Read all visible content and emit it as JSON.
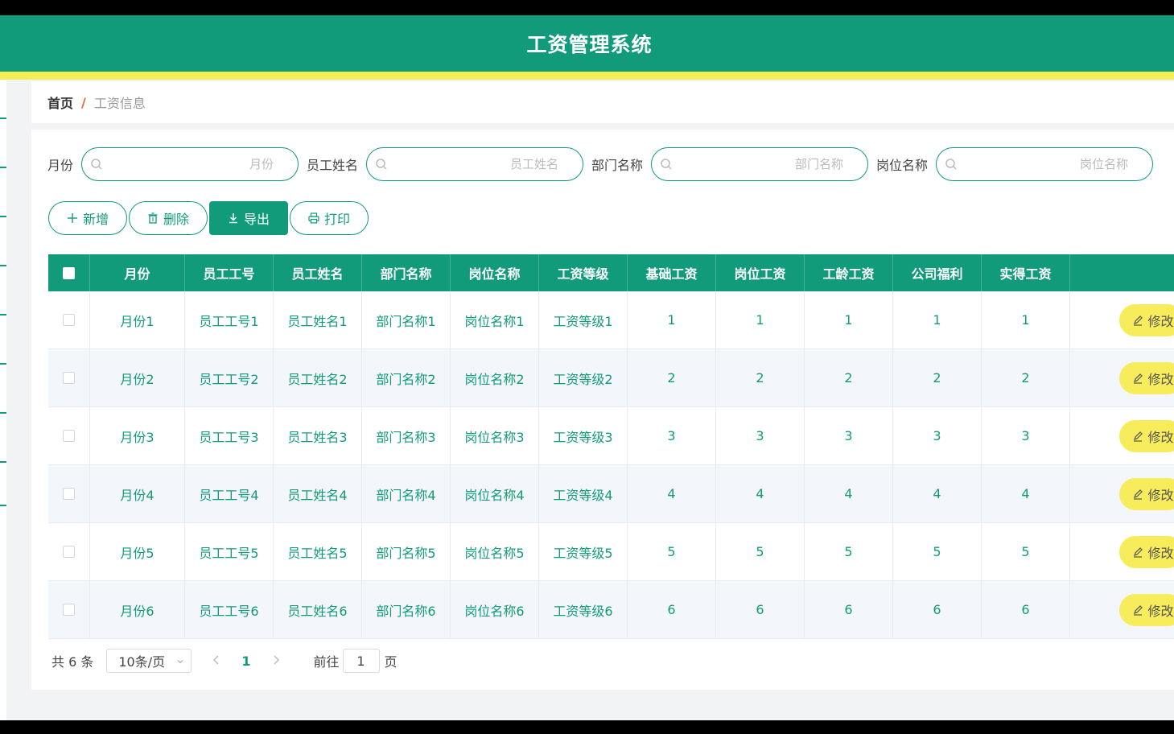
{
  "app": {
    "title": "工资管理系统"
  },
  "breadcrumb": {
    "home": "首页",
    "separator": "/",
    "current": "工资信息"
  },
  "colors": {
    "primary": "#129b7b",
    "accent_yellow": "#f1ef55",
    "edit_button": "#f6ec5c"
  },
  "search": {
    "fields": [
      {
        "label": "月份",
        "placeholder": "月份"
      },
      {
        "label": "员工姓名",
        "placeholder": "员工姓名"
      },
      {
        "label": "部门名称",
        "placeholder": "部门名称"
      },
      {
        "label": "岗位名称",
        "placeholder": "岗位名称"
      }
    ]
  },
  "toolbar": {
    "add": "新增",
    "delete": "删除",
    "export": "导出",
    "print": "打印"
  },
  "table": {
    "columns": [
      "月份",
      "员工工号",
      "员工姓名",
      "部门名称",
      "岗位名称",
      "工资等级",
      "基础工资",
      "岗位工资",
      "工龄工资",
      "公司福利",
      "实得工资"
    ],
    "action_label": "修改",
    "rows": [
      [
        "月份1",
        "员工工号1",
        "员工姓名1",
        "部门名称1",
        "岗位名称1",
        "工资等级1",
        "1",
        "1",
        "1",
        "1",
        "1"
      ],
      [
        "月份2",
        "员工工号2",
        "员工姓名2",
        "部门名称2",
        "岗位名称2",
        "工资等级2",
        "2",
        "2",
        "2",
        "2",
        "2"
      ],
      [
        "月份3",
        "员工工号3",
        "员工姓名3",
        "部门名称3",
        "岗位名称3",
        "工资等级3",
        "3",
        "3",
        "3",
        "3",
        "3"
      ],
      [
        "月份4",
        "员工工号4",
        "员工姓名4",
        "部门名称4",
        "岗位名称4",
        "工资等级4",
        "4",
        "4",
        "4",
        "4",
        "4"
      ],
      [
        "月份5",
        "员工工号5",
        "员工姓名5",
        "部门名称5",
        "岗位名称5",
        "工资等级5",
        "5",
        "5",
        "5",
        "5",
        "5"
      ],
      [
        "月份6",
        "员工工号6",
        "员工姓名6",
        "部门名称6",
        "岗位名称6",
        "工资等级6",
        "6",
        "6",
        "6",
        "6",
        "6"
      ]
    ]
  },
  "pagination": {
    "total_text": "共 6 条",
    "page_size": "10条/页",
    "current_page": "1",
    "goto_label": "前往",
    "goto_value": "1",
    "page_unit": "页"
  }
}
